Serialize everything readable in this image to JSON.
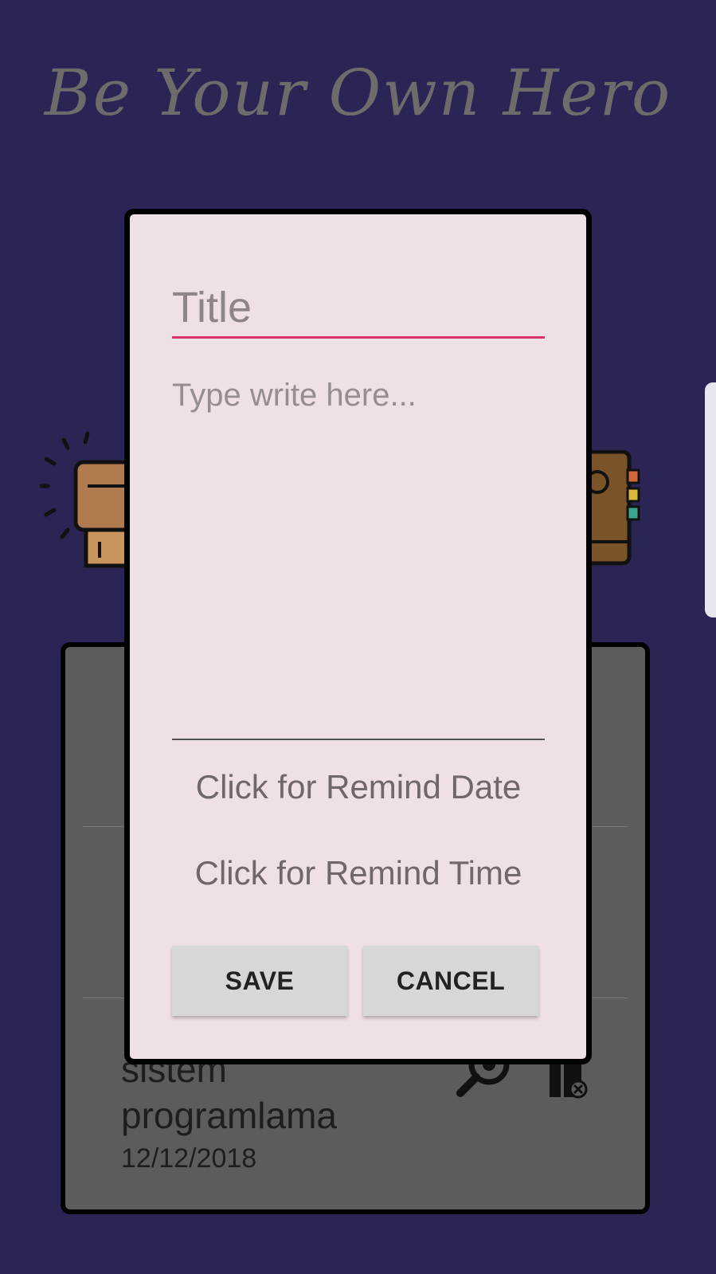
{
  "app": {
    "title": "Be Your Own Hero"
  },
  "notes": [
    {
      "title": "sistem programlama",
      "date": "12/12/2018"
    }
  ],
  "dialog": {
    "title_placeholder": "Title",
    "body_placeholder": "Type write here...",
    "remind_date_label": "Click for Remind Date",
    "remind_time_label": "Click for Remind Time",
    "save_label": "SAVE",
    "cancel_label": "CANCEL"
  },
  "colors": {
    "background": "#2a2555",
    "dialog": "#efe0e5",
    "accent": "#d6336c",
    "list_card": "#5e5b5b"
  }
}
